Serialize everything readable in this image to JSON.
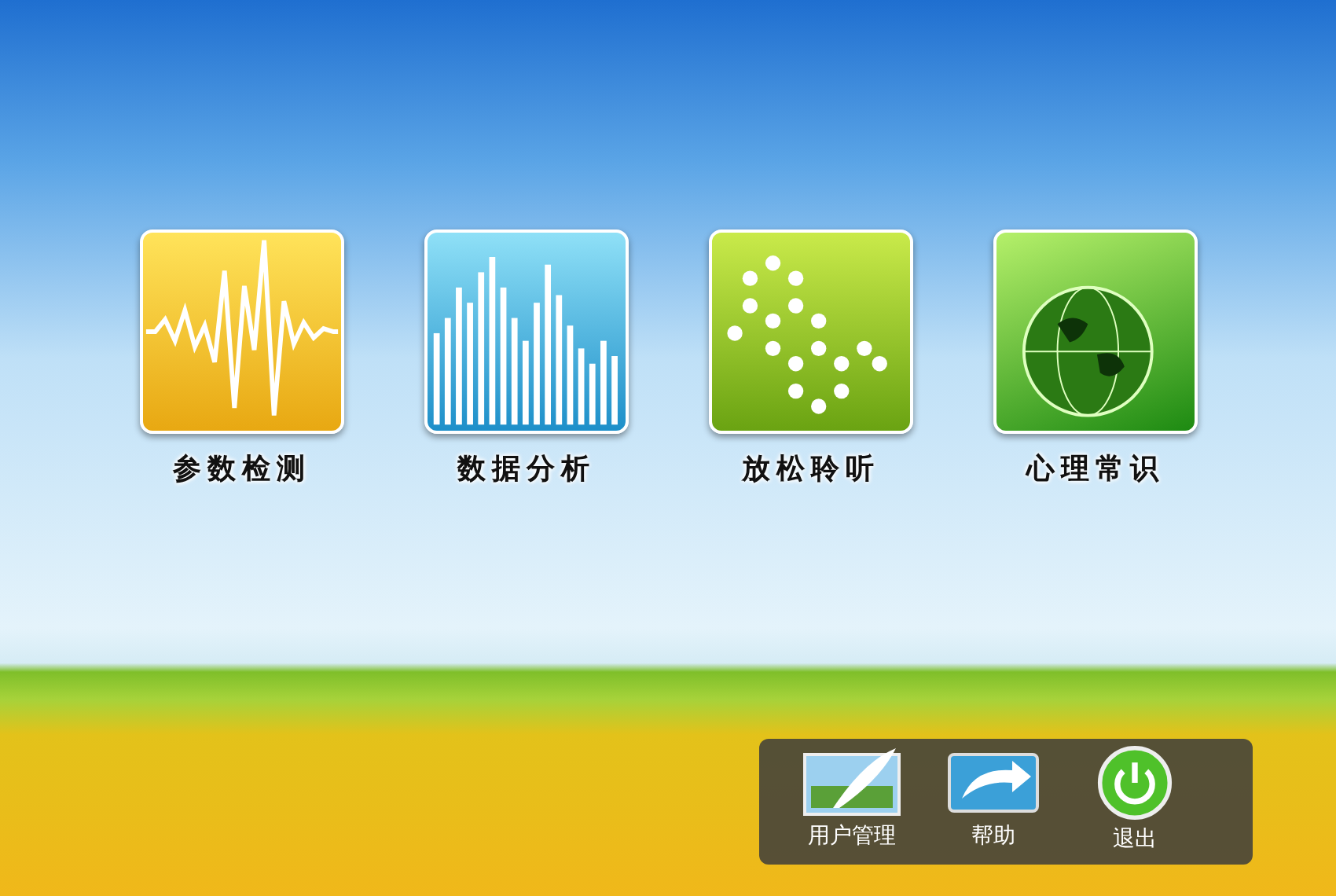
{
  "apps": [
    {
      "kind": "waveform",
      "label": "参数检测"
    },
    {
      "kind": "bars",
      "label": "数据分析"
    },
    {
      "kind": "dots",
      "label": "放松聆听"
    },
    {
      "kind": "globe",
      "label": "心理常识"
    }
  ],
  "toolbar": [
    {
      "kind": "users",
      "label": "用户管理"
    },
    {
      "kind": "help",
      "label": "帮助"
    },
    {
      "kind": "power",
      "label": "退出"
    }
  ]
}
